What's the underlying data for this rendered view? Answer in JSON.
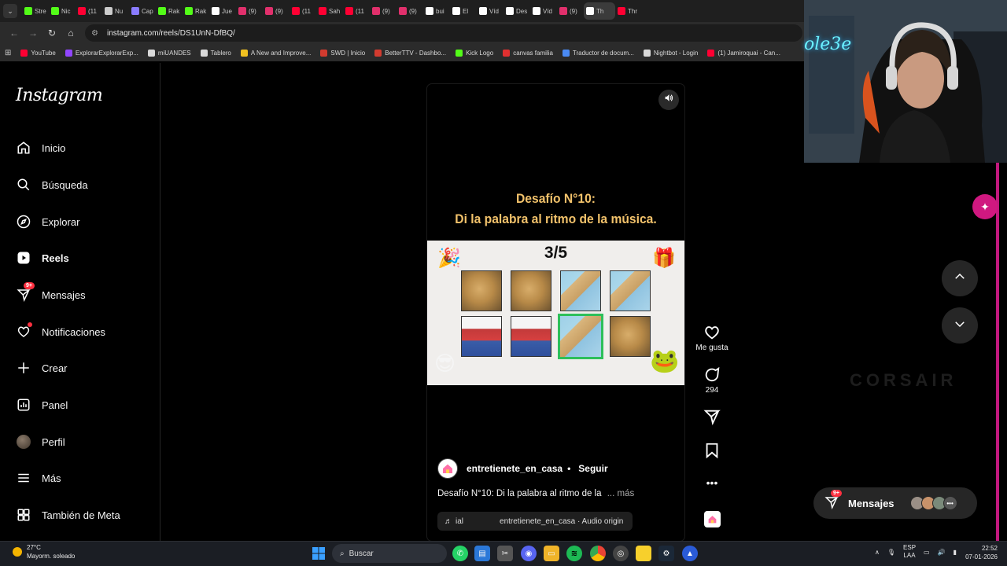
{
  "browser": {
    "tabs": [
      {
        "label": "Stre",
        "icon": "kick-icon",
        "color": "#53fc18"
      },
      {
        "label": "Nic",
        "icon": "kick-icon",
        "color": "#53fc18"
      },
      {
        "label": "(11",
        "icon": "youtube-icon",
        "color": "#ff0033"
      },
      {
        "label": "Nu",
        "icon": "github-icon",
        "color": "#cccccc"
      },
      {
        "label": "Cap",
        "icon": "pen-icon",
        "color": "#8a7cff"
      },
      {
        "label": "Rak",
        "icon": "kick-icon",
        "color": "#53fc18"
      },
      {
        "label": "Rak",
        "icon": "kick-icon",
        "color": "#53fc18"
      },
      {
        "label": "Jue",
        "icon": "tiktok-icon",
        "color": "#ffffff"
      },
      {
        "label": "(9)",
        "icon": "instagram-icon",
        "color": "#e1306c"
      },
      {
        "label": "(9)",
        "icon": "instagram-icon",
        "color": "#e1306c"
      },
      {
        "label": "(11",
        "icon": "youtube-icon",
        "color": "#ff0033"
      },
      {
        "label": "Sah",
        "icon": "youtube-icon",
        "color": "#ff0033"
      },
      {
        "label": "(11",
        "icon": "youtube-icon",
        "color": "#ff0033"
      },
      {
        "label": "(9)",
        "icon": "instagram-icon",
        "color": "#e1306c"
      },
      {
        "label": "(9)",
        "icon": "instagram-icon",
        "color": "#e1306c"
      },
      {
        "label": "bui",
        "icon": "tiktok-icon",
        "color": "#ffffff"
      },
      {
        "label": "El",
        "icon": "tiktok-icon",
        "color": "#ffffff"
      },
      {
        "label": "Víd",
        "icon": "tiktok-icon",
        "color": "#ffffff"
      },
      {
        "label": "Des",
        "icon": "tiktok-icon",
        "color": "#ffffff"
      },
      {
        "label": "Víd",
        "icon": "tiktok-icon",
        "color": "#ffffff"
      },
      {
        "label": "(9)",
        "icon": "instagram-icon",
        "color": "#e1306c"
      },
      {
        "label": "Th",
        "icon": "tiktok-icon",
        "color": "#ffffff"
      },
      {
        "label": "Thr",
        "icon": "youtube-icon",
        "color": "#ff0033"
      }
    ],
    "url": "instagram.com/reels/DS1UnN-DfBQ/",
    "bookmarks": [
      {
        "label": "YouTube",
        "color": "#ff0033"
      },
      {
        "label": "ExplorarExplorarExp...",
        "color": "#9146ff"
      },
      {
        "label": "miUANDES",
        "color": "#d8d8d8"
      },
      {
        "label": "Tablero",
        "color": "#d8d8d8"
      },
      {
        "label": "A New and Improve...",
        "color": "#f0c020"
      },
      {
        "label": "SWD | Inicio",
        "color": "#d23b2f"
      },
      {
        "label": "BetterTTV - Dashbo...",
        "color": "#d23b2f"
      },
      {
        "label": "Kick Logo",
        "color": "#53fc18"
      },
      {
        "label": "canvas familia",
        "color": "#e03030"
      },
      {
        "label": "Traductor de docum...",
        "color": "#4a8af4"
      },
      {
        "label": "Nightbot - Login",
        "color": "#d8d8d8"
      },
      {
        "label": "(1) Jamiroquai - Can...",
        "color": "#ff0033"
      }
    ]
  },
  "instagram": {
    "logo": "Instagram",
    "nav": [
      {
        "label": "Inicio",
        "icon": "home-icon"
      },
      {
        "label": "Búsqueda",
        "icon": "search-icon"
      },
      {
        "label": "Explorar",
        "icon": "compass-icon"
      },
      {
        "label": "Reels",
        "icon": "reels-icon"
      },
      {
        "label": "Mensajes",
        "icon": "messenger-icon",
        "badge": "9+"
      },
      {
        "label": "Notificaciones",
        "icon": "heart-icon"
      },
      {
        "label": "Crear",
        "icon": "plus-icon"
      },
      {
        "label": "Panel",
        "icon": "dashboard-icon"
      },
      {
        "label": "Perfil",
        "icon": "avatar"
      },
      {
        "label": "Más",
        "icon": "menu-icon"
      },
      {
        "label": "También de Meta",
        "icon": "meta-apps-icon"
      }
    ],
    "reel": {
      "title_line1": "Desafío N°10:",
      "title_line2": "Di la palabra al ritmo de la música.",
      "progress": "3/5",
      "grid": [
        [
          "potato",
          "potato",
          "map",
          "map"
        ],
        [
          "hero",
          "hero",
          "map",
          "potato"
        ]
      ],
      "highlighted_cell": 6,
      "owner": "entretienete_en_casa",
      "follow": "Seguir",
      "caption": "Desafío N°10: Di la palabra al ritmo de la",
      "more": "... más",
      "audio_prefix": "ial",
      "audio": "entretienete_en_casa · Audio origin",
      "likes_label": "Me gusta",
      "comments": "294"
    },
    "messages_pill": {
      "label": "Mensajes",
      "badge": "9+"
    }
  },
  "stream": {
    "name": "ole3e",
    "sponsor": "CORSAIR"
  },
  "taskbar": {
    "temp": "27°C",
    "weather": "Mayorm. soleado",
    "search": "Buscar",
    "lang1": "ESP",
    "lang2": "LAA",
    "time": "22:52",
    "date": "07-01-2026"
  }
}
